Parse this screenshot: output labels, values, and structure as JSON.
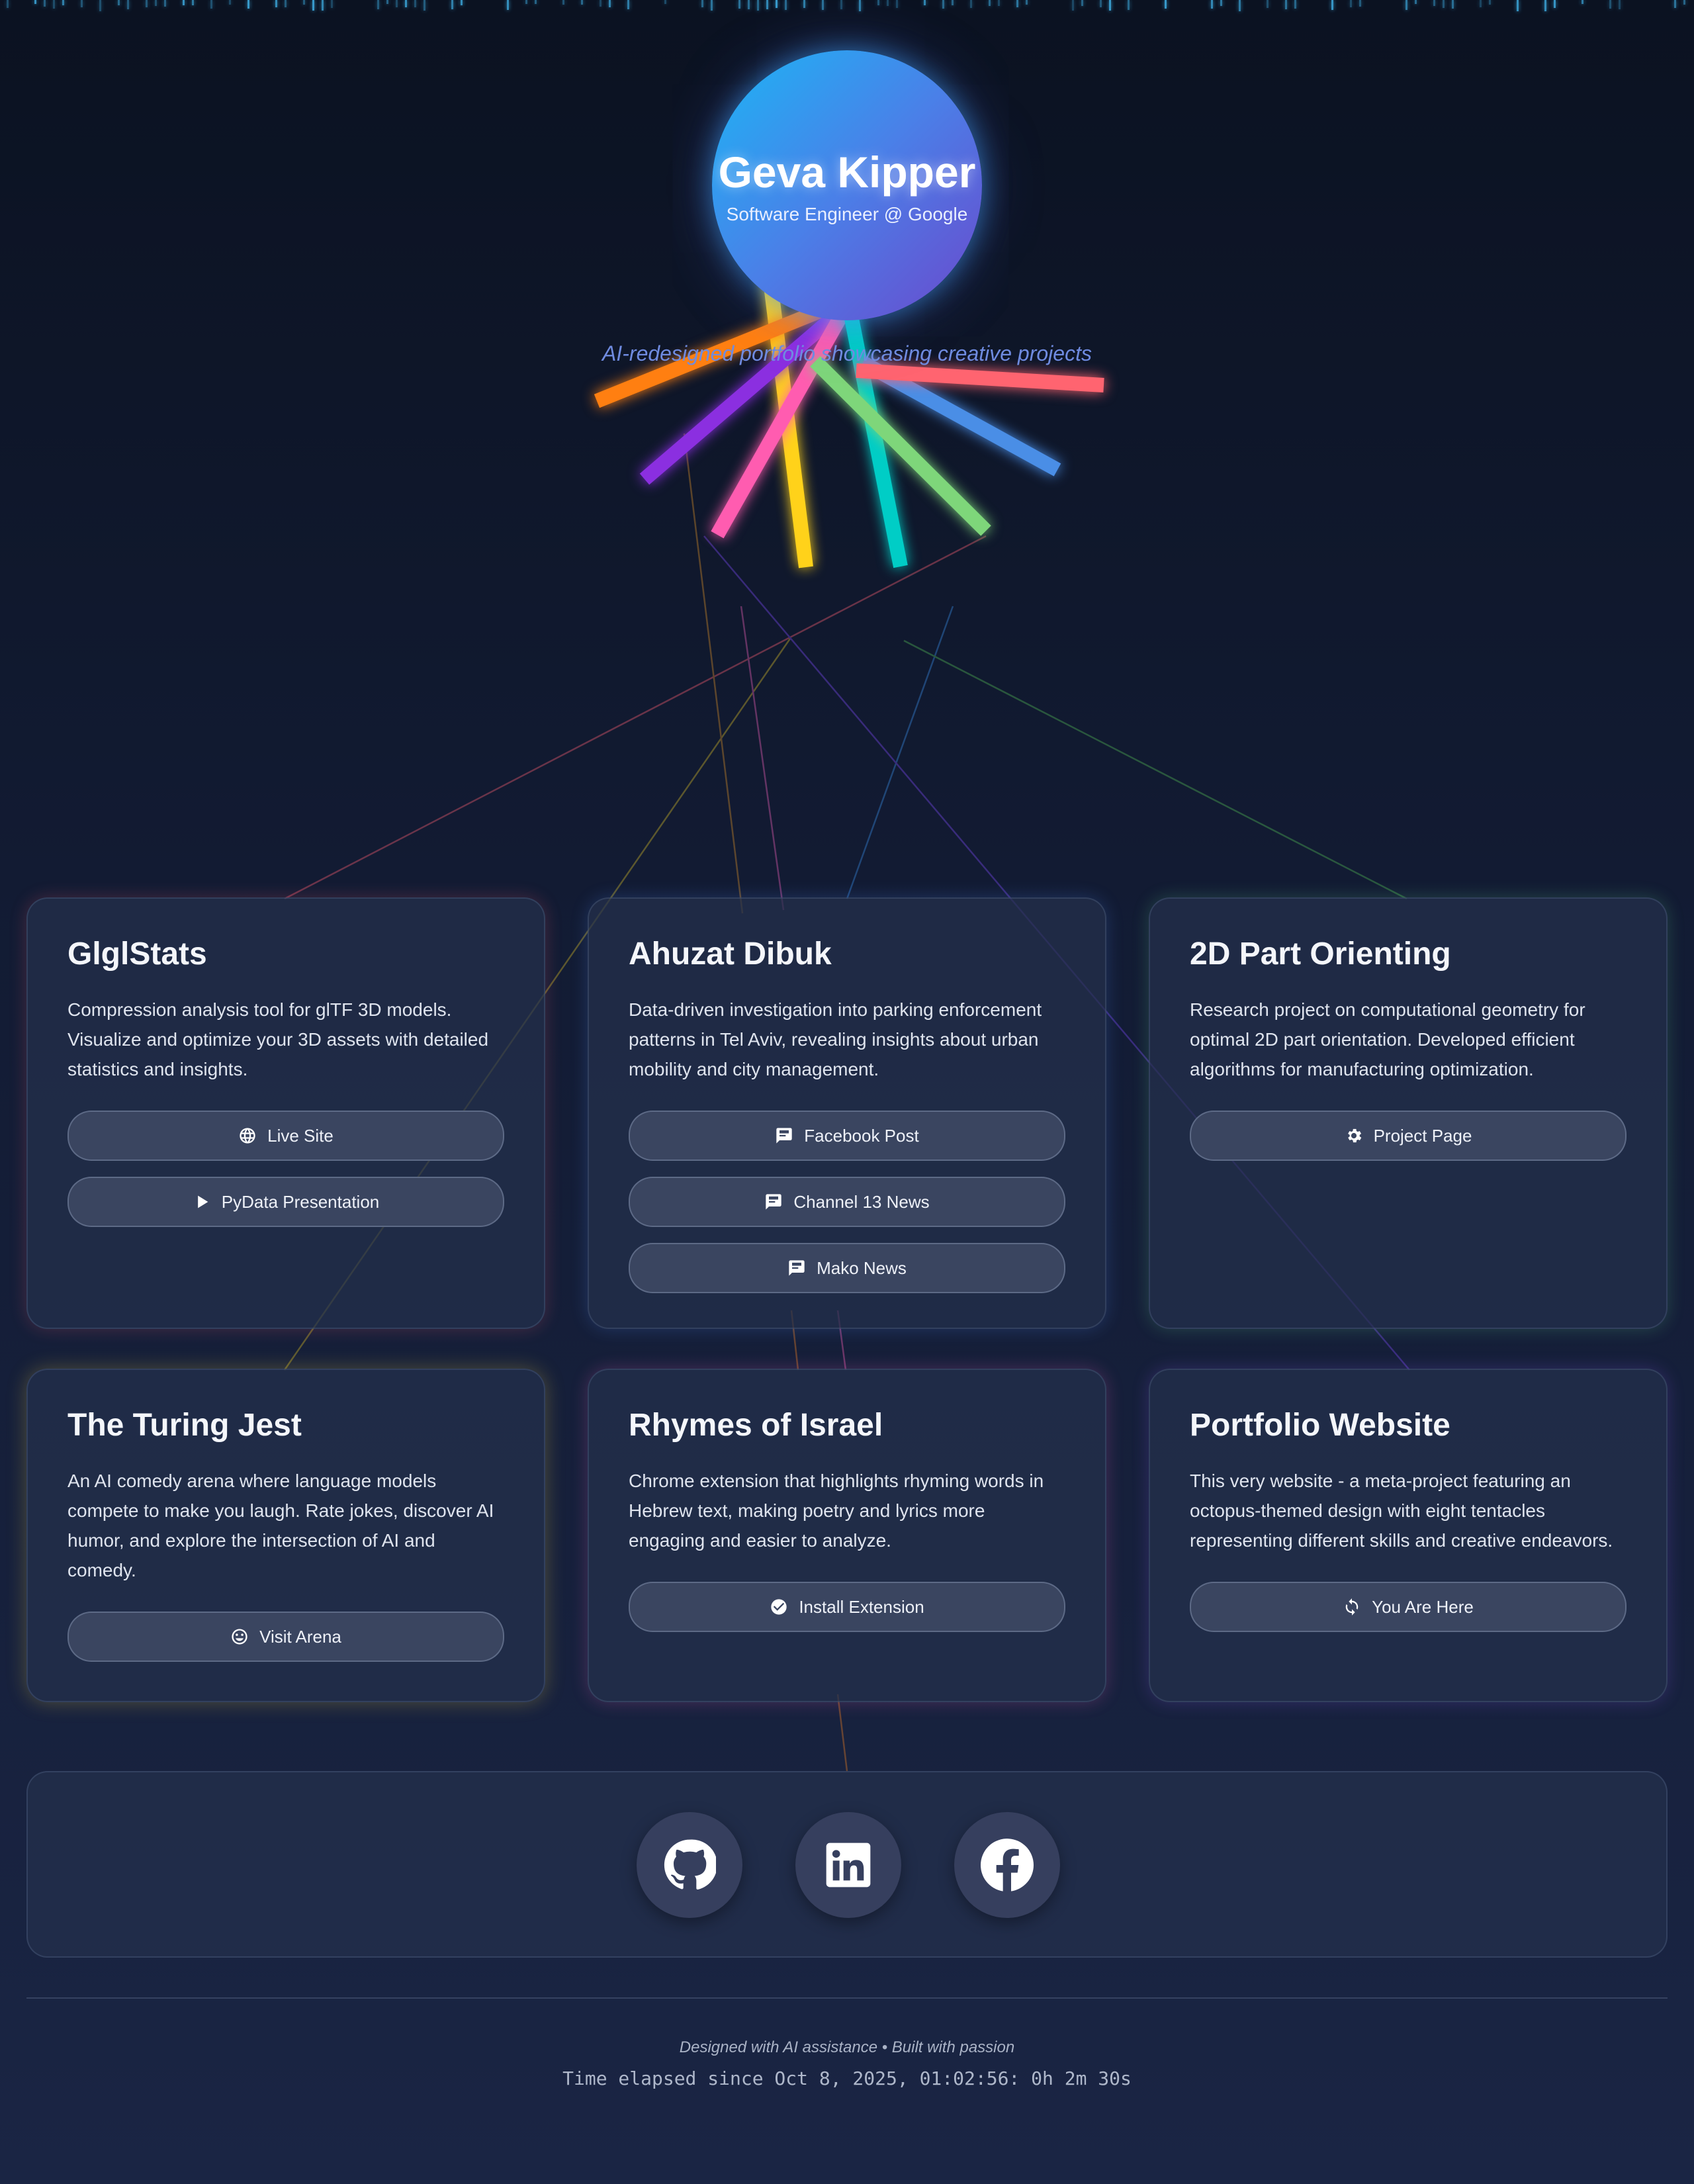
{
  "hero": {
    "name": "Geva Kipper",
    "role": "Software Engineer @ Google",
    "tagline": "AI-redesigned portfolio showcasing creative projects"
  },
  "colors": {
    "tentacles": [
      "#ffd21a",
      "#ff7f11",
      "#8b2fe0",
      "#ff5cb0",
      "#00cdc6",
      "#7ed67a",
      "#4a8ee6",
      "#ff6470"
    ]
  },
  "projects": [
    {
      "title": "GlglStats",
      "description": "Compression analysis tool for glTF 3D models. Visualize and optimize your 3D assets with detailed statistics and insights.",
      "buttons": [
        {
          "label": "Live Site",
          "icon": "globe-icon"
        },
        {
          "label": "PyData Presentation",
          "icon": "play-icon"
        }
      ]
    },
    {
      "title": "Ahuzat Dibuk",
      "description": "Data-driven investigation into parking enforcement patterns in Tel Aviv, revealing insights about urban mobility and city management.",
      "buttons": [
        {
          "label": "Facebook Post",
          "icon": "message-icon"
        },
        {
          "label": "Channel 13 News",
          "icon": "message-icon"
        },
        {
          "label": "Mako News",
          "icon": "message-icon"
        }
      ]
    },
    {
      "title": "2D Part Orienting",
      "description": "Research project on computational geometry for optimal 2D part orientation. Developed efficient algorithms for manufacturing optimization.",
      "buttons": [
        {
          "label": "Project Page",
          "icon": "gear-icon"
        }
      ]
    },
    {
      "title": "The Turing Jest",
      "description": "An AI comedy arena where language models compete to make you laugh. Rate jokes, discover AI humor, and explore the intersection of AI and comedy.",
      "buttons": [
        {
          "label": "Visit Arena",
          "icon": "smile-icon"
        }
      ]
    },
    {
      "title": "Rhymes of Israel",
      "description": "Chrome extension that highlights rhyming words in Hebrew text, making poetry and lyrics more engaging and easier to analyze.",
      "buttons": [
        {
          "label": "Install Extension",
          "icon": "check-circle-icon"
        }
      ]
    },
    {
      "title": "Portfolio Website",
      "description": "This very website - a meta-project featuring an octopus-themed design with eight tentacles representing different skills and creative endeavors.",
      "buttons": [
        {
          "label": "You Are Here",
          "icon": "refresh-icon"
        }
      ]
    }
  ],
  "social": [
    {
      "name": "GitHub",
      "icon": "github-icon"
    },
    {
      "name": "LinkedIn",
      "icon": "linkedin-icon"
    },
    {
      "name": "Facebook",
      "icon": "facebook-icon"
    }
  ],
  "footer": {
    "credit": "Designed with AI assistance • Built with passion",
    "timer": "Time elapsed since Oct 8, 2025, 01:02:56: 0h 2m 30s"
  }
}
